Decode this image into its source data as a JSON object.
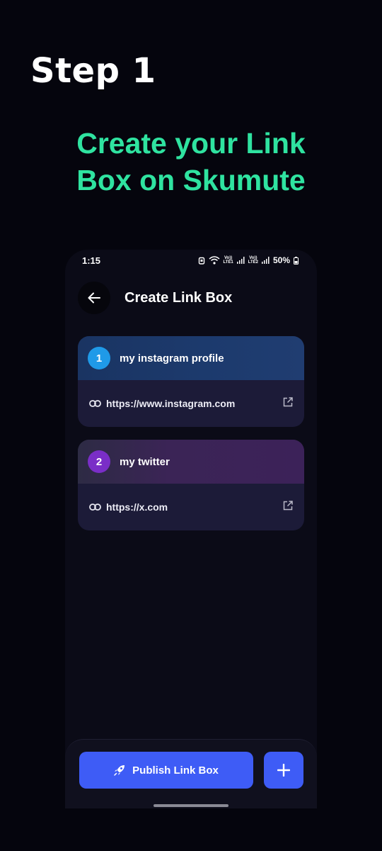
{
  "promo": {
    "step": "Step 1",
    "headline": "Create your Link Box on Skumute"
  },
  "status_bar": {
    "time": "1:15",
    "network1": "Vo))",
    "network1_sub": "LTE1",
    "network2": "Vo))",
    "network2_sub": "LTE2",
    "battery": "50%"
  },
  "header": {
    "back_icon": "arrow-left-icon",
    "title": "Create Link Box"
  },
  "links": [
    {
      "number": "1",
      "name": "my instagram profile",
      "url": "https://www.instagram.com",
      "accent": "#1f9ae8"
    },
    {
      "number": "2",
      "name": "my twitter",
      "url": "https://x.com",
      "accent": "#7a2ec7"
    }
  ],
  "actions": {
    "publish_label": "Publish Link Box",
    "publish_icon": "rocket-icon",
    "add_icon": "plus-icon"
  },
  "colors": {
    "headline": "#2fe3a0",
    "primary": "#3e5cf6",
    "background": "#05050d"
  }
}
